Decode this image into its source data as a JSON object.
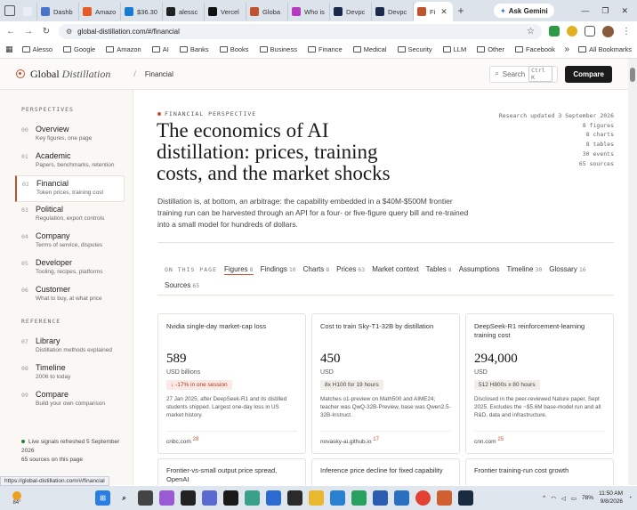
{
  "browser": {
    "tabs": [
      {
        "label": "",
        "color": "#e8eef6"
      },
      {
        "label": "Dashb",
        "color": "#4a73c9"
      },
      {
        "label": "Amazo",
        "color": "#e65a25"
      },
      {
        "label": "$36.30",
        "color": "#1a7bd4"
      },
      {
        "label": "alessc",
        "color": "#222222"
      },
      {
        "label": "Vercel",
        "color": "#111111"
      },
      {
        "label": "Globa",
        "color": "#c0532d"
      },
      {
        "label": "Who is",
        "color": "#b33ac1"
      },
      {
        "label": "Devpc",
        "color": "#1b2a4a"
      },
      {
        "label": "Devpc",
        "color": "#1b2a4a"
      },
      {
        "label": "Fi",
        "color": "#c0532d",
        "active": true
      }
    ],
    "ask_gemini": "Ask Gemini",
    "url": "global-distillation.com/#/financial",
    "bookmarks": [
      "Alesso",
      "Google",
      "Amazon",
      "AI",
      "Banks",
      "Books",
      "Business",
      "Finance",
      "Medical",
      "Security",
      "LLM",
      "Other",
      "Facebook"
    ],
    "all_bookmarks": "All Bookmarks",
    "status_url": "https://global-distillation.com/#/financial"
  },
  "header": {
    "brand_a": "Global",
    "brand_b": "Distillation",
    "crumb_sep": "/",
    "crumb": "Financial",
    "search_label": "Search",
    "search_kbd": "Ctrl K",
    "compare_label": "Compare"
  },
  "sidebar": {
    "perspectives_label": "PERSPECTIVES",
    "items": [
      {
        "num": "00",
        "title": "Overview",
        "sub": "Key figures, one page"
      },
      {
        "num": "01",
        "title": "Academic",
        "sub": "Papers, benchmarks, retention"
      },
      {
        "num": "02",
        "title": "Financial",
        "sub": "Token prices, training cost"
      },
      {
        "num": "03",
        "title": "Political",
        "sub": "Regulation, export controls"
      },
      {
        "num": "04",
        "title": "Company",
        "sub": "Terms of service, disputes"
      },
      {
        "num": "05",
        "title": "Developer",
        "sub": "Tooling, recipes, platforms"
      },
      {
        "num": "06",
        "title": "Customer",
        "sub": "What to buy, at what price"
      }
    ],
    "reference_label": "REFERENCE",
    "ref_items": [
      {
        "num": "07",
        "title": "Library",
        "sub": "Distillation methods explained"
      },
      {
        "num": "08",
        "title": "Timeline",
        "sub": "2006 to today"
      },
      {
        "num": "09",
        "title": "Compare",
        "sub": "Build your own comparison"
      }
    ],
    "live_text": "Live signals refreshed 5 September 2026",
    "live_sub": "65 sources on this page"
  },
  "main": {
    "eyebrow": "FINANCIAL PERSPECTIVE",
    "title": "The economics of AI distillation: prices, training costs, and the market shocks",
    "lede": "Distillation is, at bottom, an arbitrage: the capability embedded in a $40M-$500M frontier training run can be harvested through an API for a four- or five-figure query bill and re-trained into a small model for hundreds of dollars.",
    "meta": [
      "Research updated 3 September 2026",
      "8 figures",
      "8 charts",
      "8 tables",
      "30 events",
      "65 sources"
    ],
    "toc_label": "ON THIS PAGE",
    "toc": [
      {
        "label": "Figures",
        "count": "8",
        "active": true
      },
      {
        "label": "Findings",
        "count": "10"
      },
      {
        "label": "Charts",
        "count": "8"
      },
      {
        "label": "Prices",
        "count": "63"
      },
      {
        "label": "Market context",
        "count": ""
      },
      {
        "label": "Tables",
        "count": "8"
      },
      {
        "label": "Assumptions",
        "count": ""
      },
      {
        "label": "Timeline",
        "count": "30"
      },
      {
        "label": "Glossary",
        "count": "16"
      },
      {
        "label": "Sources",
        "count": "65"
      }
    ],
    "cards": [
      {
        "title": "Nvidia single-day market-cap loss",
        "value": "589",
        "unit": "USD billions",
        "chip": "↓ -17% in one session",
        "chip_neg": true,
        "desc": "27 Jan 2025, after DeepSeek-R1 and its distilled students shipped. Largest one-day loss in US market history.",
        "source": "cnbc.com",
        "ref": "28"
      },
      {
        "title": "Cost to train Sky-T1-32B by distillation",
        "value": "450",
        "unit": "USD",
        "chip": "8x H100 for 19 hours",
        "chip_neg": false,
        "desc": "Matches o1-preview on Math500 and AIME24; teacher was QwQ-32B-Preview, base was Qwen2.5-32B-Instruct.",
        "source": "novasky-ai.github.io",
        "ref": "17"
      },
      {
        "title": "DeepSeek-R1 reinforcement-learning training cost",
        "value": "294,000",
        "unit": "USD",
        "chip": "512 H800s x 80 hours",
        "chip_neg": false,
        "desc": "Disclosed in the peer-reviewed Nature paper, Sept 2025. Excludes the ~$5.6M base-model run and all R&D, data and infrastructure.",
        "source": "cnn.com",
        "ref": "25"
      }
    ],
    "cards2": [
      "Frontier-vs-small output price spread, OpenAI",
      "Inference price decline for fixed capability",
      "Frontier training-run cost growth"
    ]
  },
  "taskbar": {
    "temp": "84°",
    "battery": "78%",
    "time": "11:50 AM",
    "date": "9/8/2026"
  }
}
